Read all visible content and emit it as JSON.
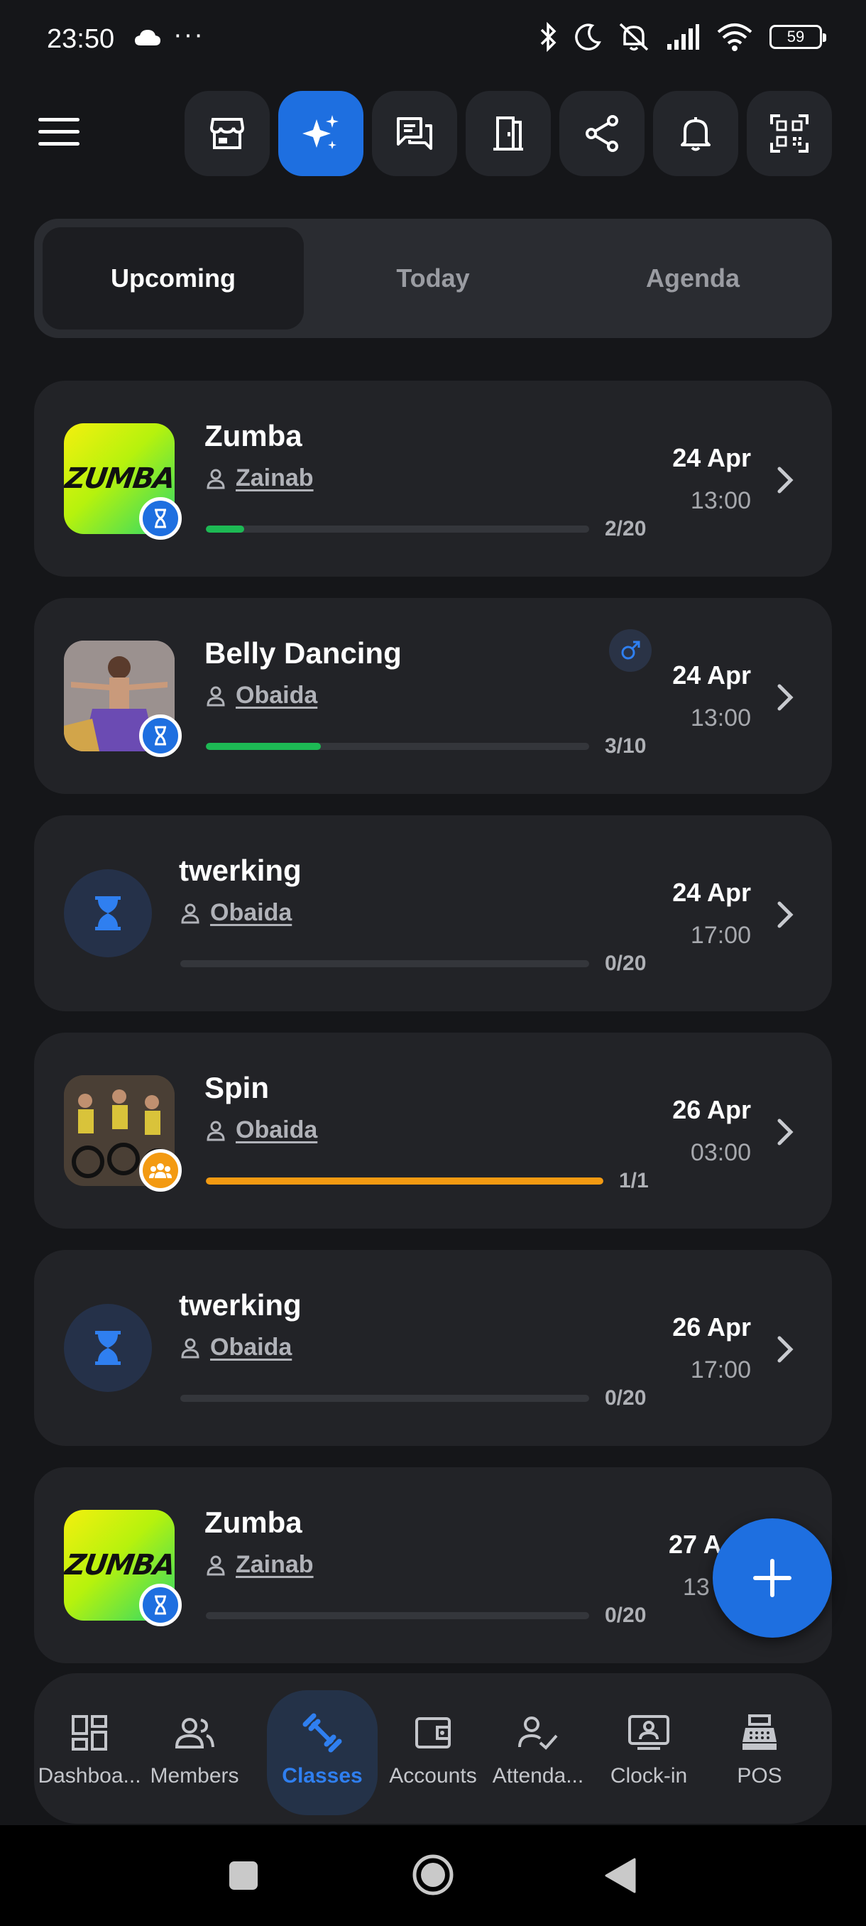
{
  "status_bar": {
    "time": "23:50",
    "dots": "···",
    "battery": "59"
  },
  "header": {
    "buttons": [
      {
        "icon": "store-icon"
      },
      {
        "icon": "sparkles-icon",
        "active": true
      },
      {
        "icon": "chat-icon"
      },
      {
        "icon": "door-icon"
      },
      {
        "icon": "share-icon"
      },
      {
        "icon": "bell-icon"
      },
      {
        "icon": "qr-code-icon"
      }
    ]
  },
  "tabs": {
    "upcoming": "Upcoming",
    "today": "Today",
    "agenda": "Agenda"
  },
  "classes": [
    {
      "title": "Zumba",
      "trainer": "Zainab",
      "count": "2/20",
      "filled": 0.1,
      "date": "24 Apr",
      "time": "13:00",
      "image": "zumba-logo",
      "logo_text": "ZUMBA"
    },
    {
      "title": "Belly Dancing",
      "trainer": "Obaida",
      "count": "3/10",
      "filled": 0.3,
      "date": "24 Apr",
      "time": "13:00",
      "image": "photo"
    },
    {
      "title": "twerking",
      "trainer": "Obaida",
      "count": "0/20",
      "filled": 0,
      "date": "24 Apr",
      "time": "17:00",
      "image": "none"
    },
    {
      "title": "Spin",
      "trainer": "Obaida",
      "count": "1/1",
      "filled": 1,
      "date": "26 Apr",
      "time": "03:00",
      "image": "photo"
    },
    {
      "title": "twerking",
      "trainer": "Obaida",
      "count": "0/20",
      "filled": 0,
      "date": "26 Apr",
      "time": "17:00",
      "image": "none"
    },
    {
      "title": "Zumba",
      "trainer": "Zainab",
      "count": "0/20",
      "filled": 0,
      "date": "27 A",
      "time": "13",
      "image": "zumba-logo",
      "logo_text": "ZUMBA"
    }
  ],
  "bottom_nav": {
    "dashboard": "Dashboa...",
    "members": "Members",
    "classes": "Classes",
    "accounts": "Accounts",
    "attendance": "Attenda...",
    "clock_in": "Clock-in",
    "pos": "POS"
  },
  "colors": {
    "accent": "#1e6fe0",
    "progress_green": "#1db954",
    "progress_orange": "#f39a12"
  }
}
